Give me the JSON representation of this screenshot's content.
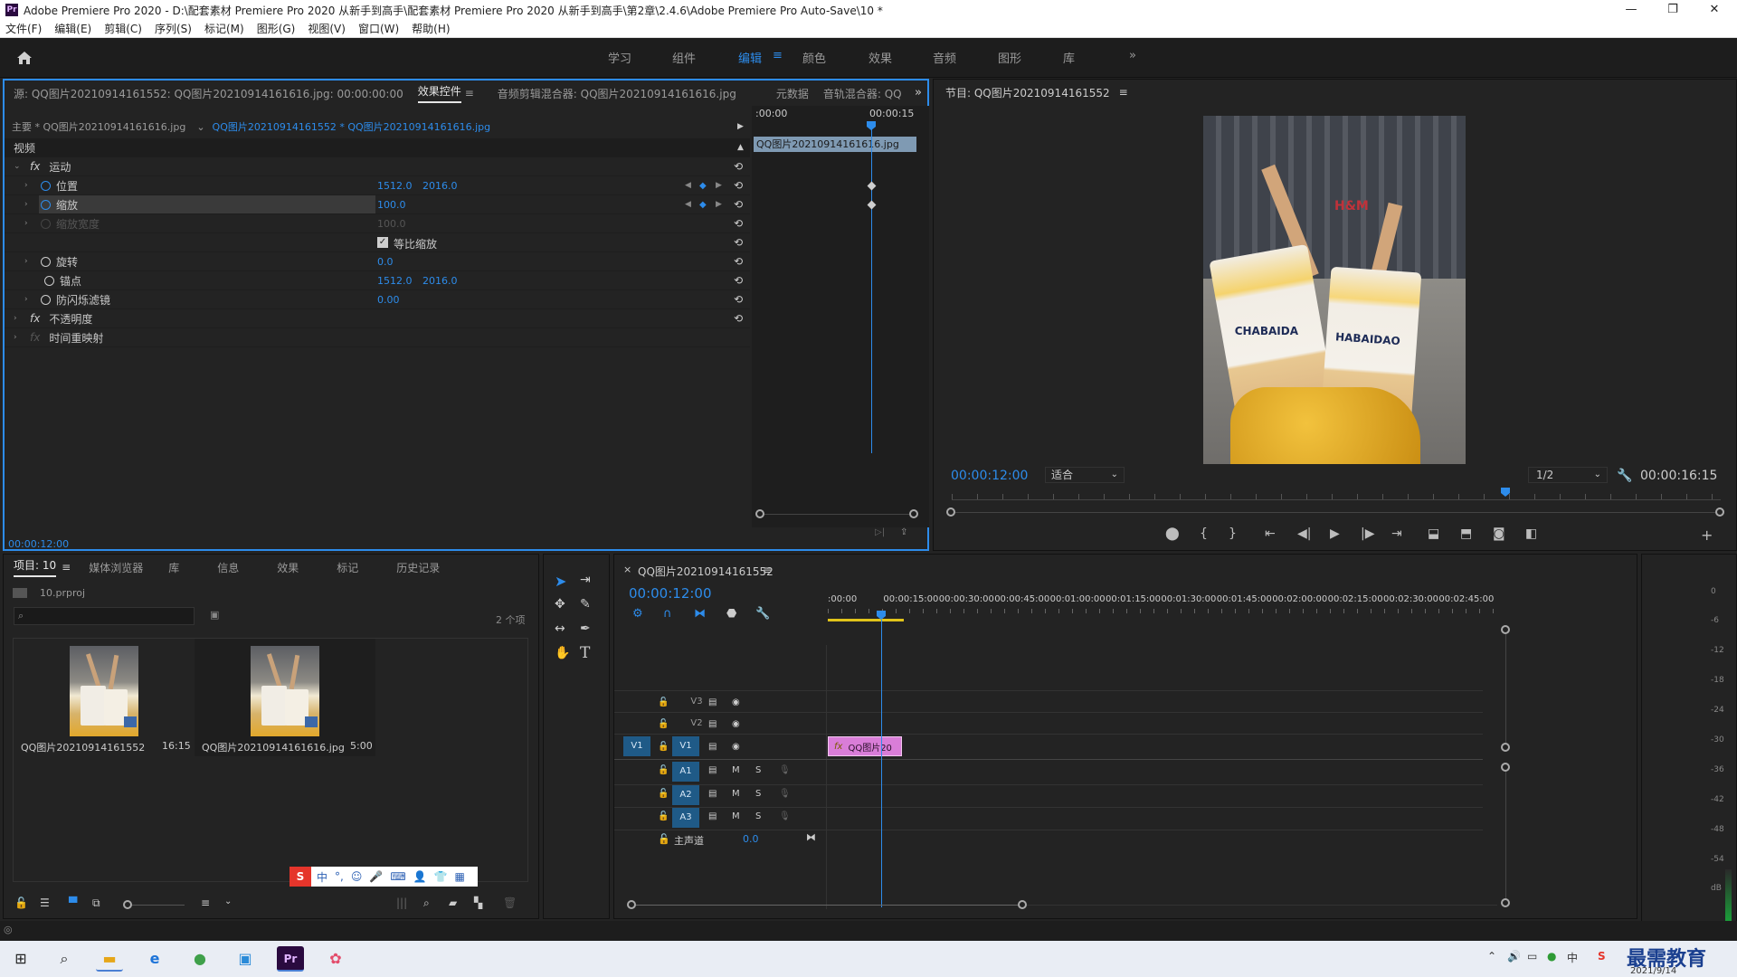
{
  "window": {
    "title": "Adobe Premiere Pro 2020 - D:\\配套素材 Premiere Pro 2020 从新手到高手\\配套素材 Premiere Pro 2020 从新手到高手\\第2章\\2.4.6\\Adobe Premiere Pro Auto-Save\\10 *",
    "app_icon": "Pr",
    "minimize": "—",
    "maximize": "❐",
    "close": "✕"
  },
  "menu": [
    "文件(F)",
    "编辑(E)",
    "剪辑(C)",
    "序列(S)",
    "标记(M)",
    "图形(G)",
    "视图(V)",
    "窗口(W)",
    "帮助(H)"
  ],
  "workspaces": {
    "tabs": [
      "学习",
      "组件",
      "编辑",
      "颜色",
      "效果",
      "音频",
      "图形",
      "库"
    ],
    "active": "编辑",
    "more": "»"
  },
  "effect_controls": {
    "tabs": [
      "源: QQ图片20210914161552: QQ图片20210914161616.jpg: 00:00:00:00",
      "效果控件",
      "音频剪辑混合器: QQ图片20210914161616.jpg",
      "元数据",
      "音轨混合器: QQ"
    ],
    "master_clip": "主要 * QQ图片20210914161616.jpg",
    "sequence_clip": "QQ图片20210914161552 * QQ图片20210914161616.jpg",
    "ruler_start": ":00:00",
    "ruler_end": "00:00:15",
    "clip_bar_label": "QQ图片20210914161616.jpg",
    "section_video": "视频",
    "fx": "fx",
    "motion": "运动",
    "position_label": "位置",
    "position_x": "1512.0",
    "position_y": "2016.0",
    "scale_label": "缩放",
    "scale_value": "100.0",
    "scale_width_label": "缩放宽度",
    "scale_width_value": "100.0",
    "uniform_scale_label": "等比缩放",
    "rotation_label": "旋转",
    "rotation_value": "0.0",
    "anchor_label": "锚点",
    "anchor_x": "1512.0",
    "anchor_y": "2016.0",
    "flicker_label": "防闪烁滤镜",
    "flicker_value": "0.00",
    "opacity_label": "不透明度",
    "time_remap_label": "时间重映射",
    "timecode": "00:00:12:00"
  },
  "program_monitor": {
    "title": "节目: QQ图片20210914161552",
    "timecode": "00:00:12:00",
    "fit": "适合",
    "resolution": "1/2",
    "duration": "00:00:16:15",
    "photo_sign": "H&M",
    "cup_text_left": "CHABAIDA",
    "cup_text_right": "HABAIDAO",
    "playhead_fraction": 0.72
  },
  "project": {
    "tabs": [
      "项目: 10",
      "媒体浏览器",
      "库",
      "信息",
      "效果",
      "标记",
      "历史记录"
    ],
    "file": "10.prproj",
    "count": "2 个项",
    "items": [
      {
        "name": "QQ图片20210914161552",
        "duration": "16:15"
      },
      {
        "name": "QQ图片20210914161616.jpg",
        "duration": "5:00"
      }
    ]
  },
  "timeline": {
    "title": "QQ图片20210914161552",
    "close": "×",
    "timecode": "00:00:12:00",
    "ruler": [
      ":00:00",
      "00:00:15:00",
      "00:00:30:00",
      "00:00:45:00",
      "00:01:00:00",
      "00:01:15:00",
      "00:01:30:00",
      "00:01:45:00",
      "00:02:00:00",
      "00:02:15:00",
      "00:02:30:00",
      "00:02:45:00"
    ],
    "video_tracks": [
      "V3",
      "V2",
      "V1"
    ],
    "audio_tracks": [
      "A1",
      "A2",
      "A3"
    ],
    "source_patch": "V1",
    "mute": "M",
    "solo": "S",
    "master_label": "主声道",
    "master_value": "0.0",
    "clip_label": "QQ图片20"
  },
  "meter": {
    "labels": [
      "0",
      "-6",
      "-12",
      "-18",
      "-24",
      "-30",
      "-36",
      "-42",
      "-48",
      "-54",
      "dB"
    ]
  },
  "ime": [
    "中",
    "°,",
    "☺",
    "🎤",
    "⌨",
    "👤",
    "👕",
    "▦"
  ],
  "taskbar": {
    "date": "2021/9/14",
    "watermark": "最需教育",
    "tray_icon": "S"
  }
}
